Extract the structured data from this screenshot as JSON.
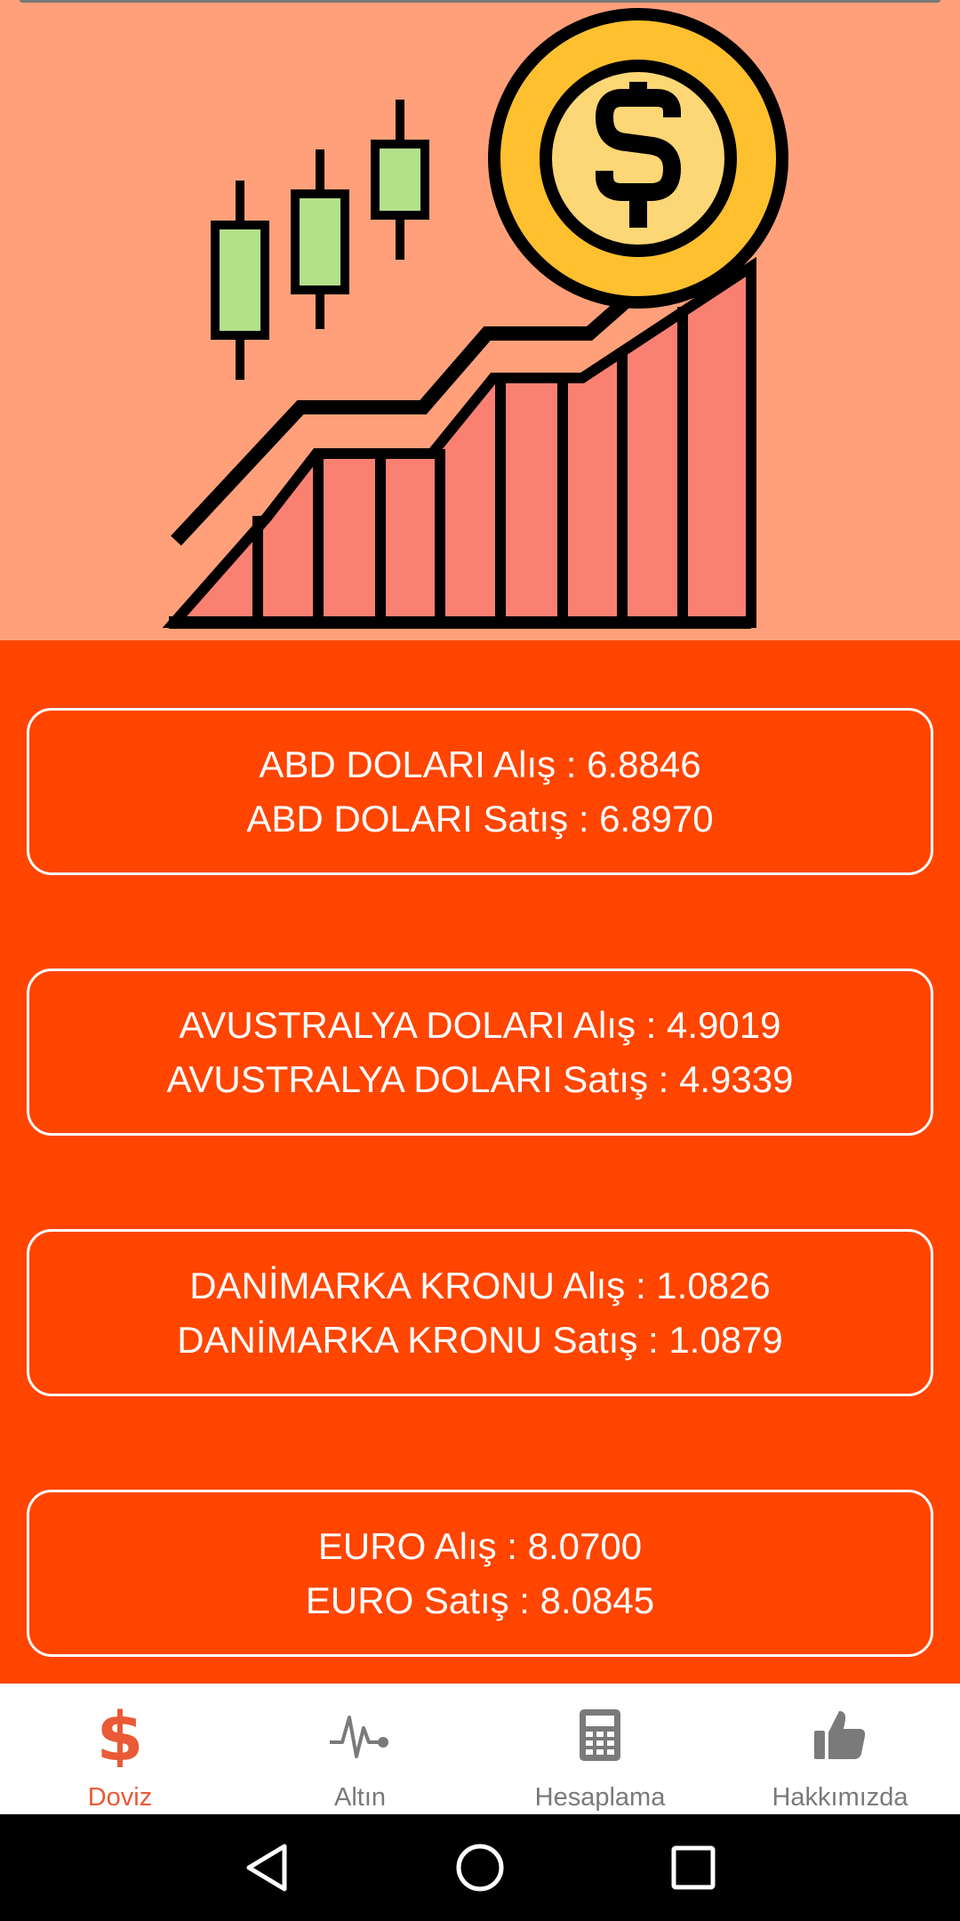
{
  "rates": [
    {
      "buy": "ABD DOLARI Alış : 6.8846",
      "sell": "ABD DOLARI Satış : 6.8970"
    },
    {
      "buy": "AVUSTRALYA DOLARI Alış : 4.9019",
      "sell": "AVUSTRALYA DOLARI Satış : 4.9339"
    },
    {
      "buy": "DANİMARKA KRONU Alış : 1.0826",
      "sell": "DANİMARKA KRONU Satış : 1.0879"
    },
    {
      "buy": "EURO Alış : 8.0700",
      "sell": "EURO Satış : 8.0845"
    }
  ],
  "nav": {
    "items": [
      {
        "label": "Doviz",
        "icon": "dollar-icon",
        "active": true
      },
      {
        "label": "Altın",
        "icon": "pulse-icon",
        "active": false
      },
      {
        "label": "Hesaplama",
        "icon": "calculator-icon",
        "active": false
      },
      {
        "label": "Hakkımızda",
        "icon": "thumbs-up-icon",
        "active": false
      }
    ]
  },
  "system_nav": {
    "back": "back-icon",
    "home": "home-icon",
    "recents": "recents-icon"
  },
  "colors": {
    "hero_background": "#ffa07a",
    "content_background": "#ff4500",
    "card_border": "#ffffff",
    "active_nav": "#ea5a36",
    "inactive_nav": "#7a7a7a"
  }
}
